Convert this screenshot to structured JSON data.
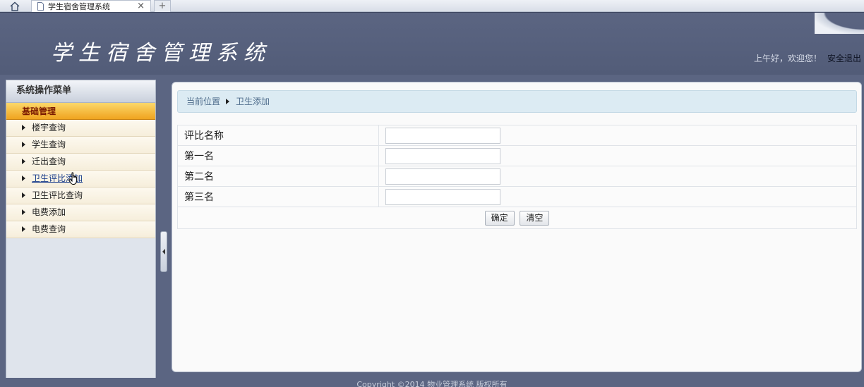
{
  "browser": {
    "tab_title": "学生宿舍管理系统",
    "close_glyph": "×",
    "new_tab_glyph": "+"
  },
  "header": {
    "title": "学生宿舍管理系统",
    "greeting": "上午好，欢迎您！",
    "logout": "安全退出"
  },
  "sidebar": {
    "title": "系统操作菜单",
    "group": "基础管理",
    "items": [
      {
        "label": "楼宇查询"
      },
      {
        "label": "学生查询"
      },
      {
        "label": "迁出查询"
      },
      {
        "label": "卫生评比添加"
      },
      {
        "label": "卫生评比查询"
      },
      {
        "label": "电费添加"
      },
      {
        "label": "电费查询"
      }
    ]
  },
  "breadcrumb": {
    "prefix": "当前位置",
    "current": "卫生添加"
  },
  "form": {
    "rows": [
      {
        "label": "评比名称",
        "value": ""
      },
      {
        "label": "第一名",
        "value": ""
      },
      {
        "label": "第二名",
        "value": ""
      },
      {
        "label": "第三名",
        "value": ""
      }
    ],
    "submit_label": "确定",
    "clear_label": "清空"
  },
  "footer": {
    "text": "Copyright ©2014 物业管理系统 版权所有"
  },
  "colors": {
    "header_bg": "#5b6582",
    "menu_group_bg": "#f0a41f",
    "breadcrumb_bg": "#dcebf3"
  },
  "icons": [
    "home-icon",
    "page-icon",
    "close-icon",
    "hand-cursor-icon",
    "collapse-arrow-icon"
  ]
}
